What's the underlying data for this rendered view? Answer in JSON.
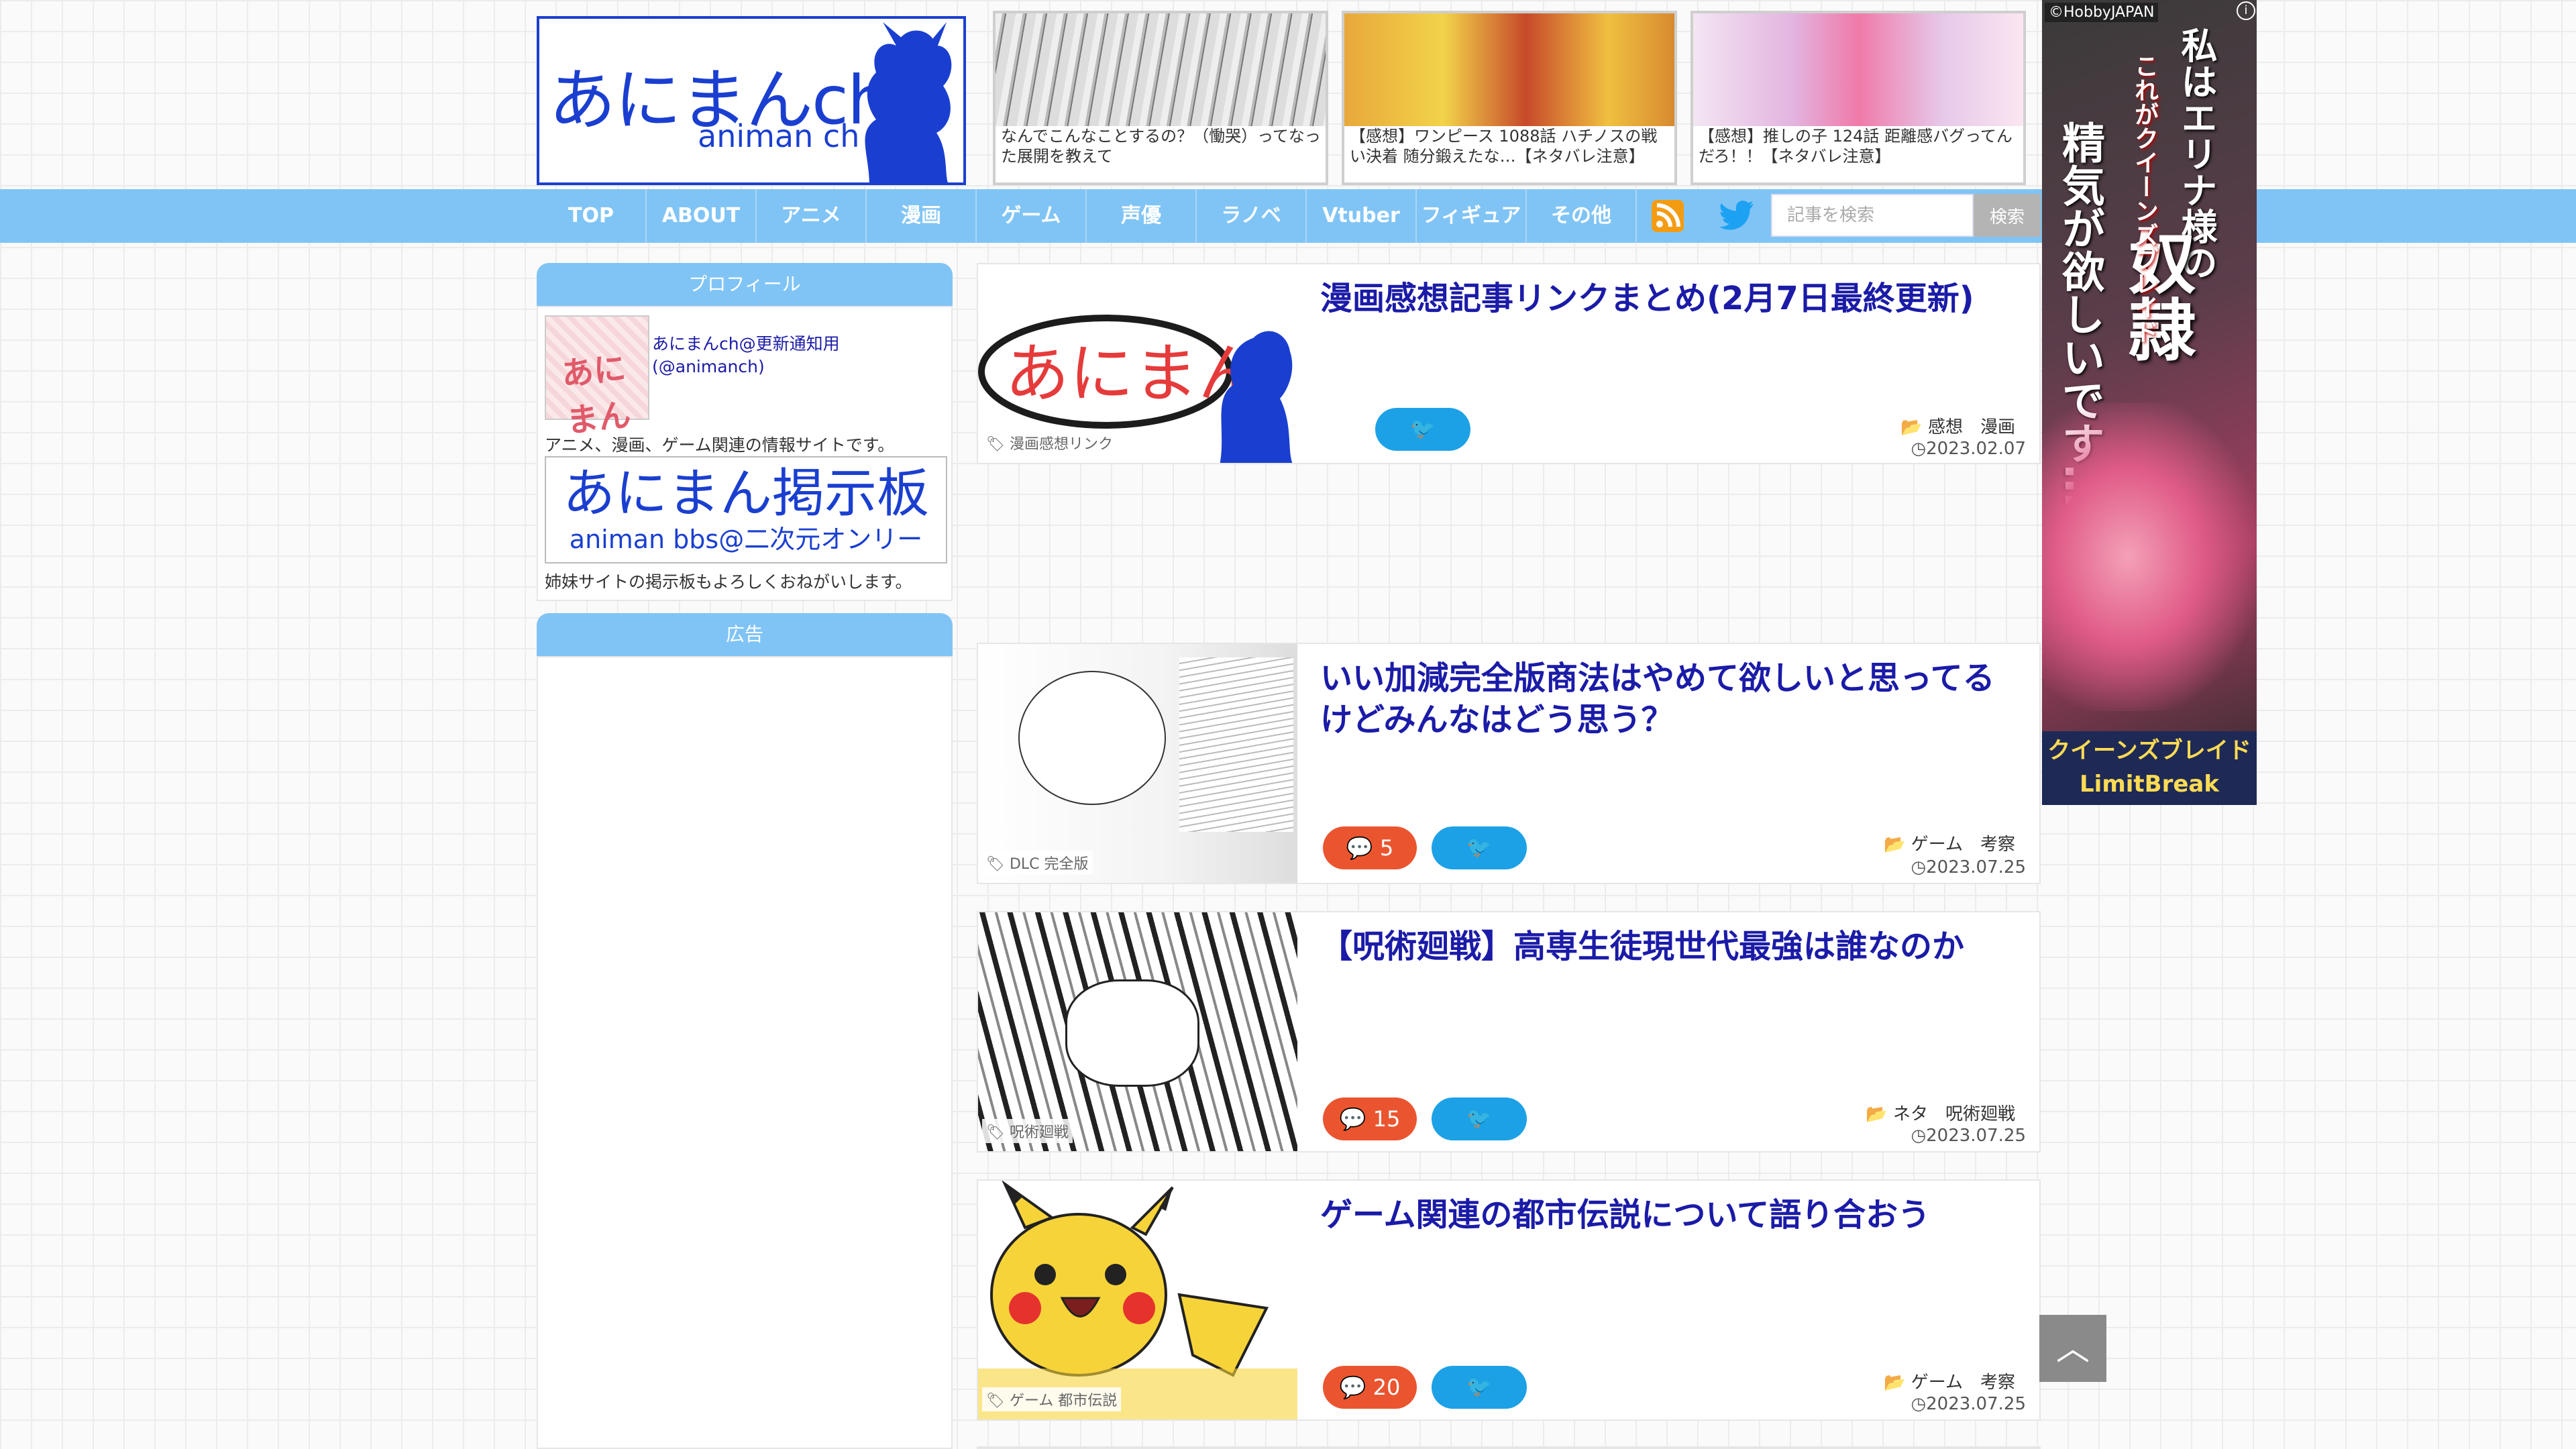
{
  "header": {
    "logo_text": "あにまんch",
    "logo_sub": "animan ch",
    "top_stories": [
      {
        "caption": "なんでこんなことするの？（慟哭）ってなった展開を教えて"
      },
      {
        "caption": "【感想】ワンピース 1088話 ハチノスの戦い決着 随分鍛えたな…【ネタバレ注意】"
      },
      {
        "caption": "【感想】推しの子 124話 距離感バグってんだろ！！【ネタバレ注意】"
      }
    ]
  },
  "nav": {
    "items": [
      "TOP",
      "ABOUT",
      "アニメ",
      "漫画",
      "ゲーム",
      "声優",
      "ラノベ",
      "Vtuber",
      "フィギュア",
      "その他"
    ],
    "search_placeholder": "記事を検索",
    "search_button": "検索"
  },
  "sidebar": {
    "profile_heading": "プロフィール",
    "profile_name": "あにまんch@更新通知用",
    "profile_handle": "(@animanch)",
    "profile_desc": "アニメ、漫画、ゲーム関連の情報サイトです。",
    "bbs_logo": "あにまん掲示板",
    "bbs_sub": "animan bbs@二次元オンリー",
    "bbs_desc": "姉妹サイトの掲示板もよろしくおねがいします。",
    "ad_heading": "広告"
  },
  "articles": [
    {
      "title": "漫画感想記事リンクまとめ(2月7日最終更新)",
      "tags": "漫画感想リンク",
      "category": "感想　漫画",
      "date": "2023.02.07",
      "comments": ""
    },
    {
      "title": "いい加減完全版商法はやめて欲しいと思ってるけどみんなはどう思う？",
      "tags": "DLC 完全版",
      "category": "ゲーム　考察",
      "date": "2023.07.25",
      "comments": "5"
    },
    {
      "title": "【呪術廻戦】高専生徒現世代最強は誰なのか",
      "tags": "呪術廻戦",
      "category": "ネタ　呪術廻戦",
      "date": "2023.07.25",
      "comments": "15"
    },
    {
      "title": "ゲーム関連の都市伝説について語り合おう",
      "tags": "ゲーム 都市伝説",
      "category": "ゲーム　考察",
      "date": "2023.07.25",
      "comments": "20"
    }
  ],
  "right_ad": {
    "copyright": "©HobbyJAPAN",
    "line1": "私はエリナ様の",
    "line2": "奴隷",
    "line3": "精気が欲しいです…",
    "line4": "これがクイーンズブレイド",
    "brand": "クイーンズブレイド LimitBreak"
  }
}
